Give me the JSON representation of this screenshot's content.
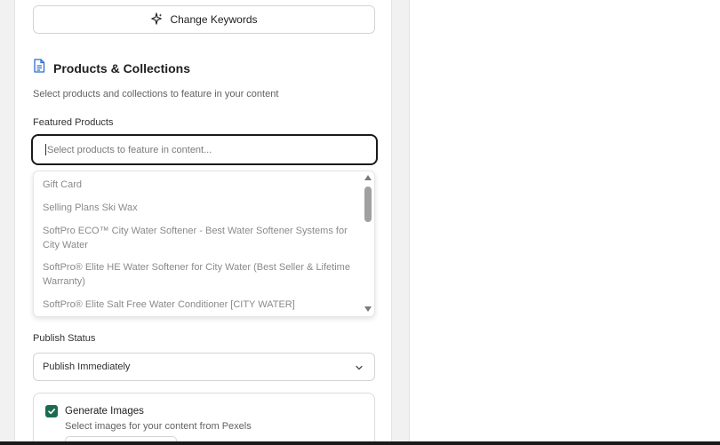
{
  "keywords": {
    "change_label": "Change Keywords",
    "icon": "sparkle-icon"
  },
  "products_section": {
    "title": "Products & Collections",
    "icon": "document-icon",
    "description": "Select products and collections to feature in your content",
    "featured_label": "Featured Products",
    "input_placeholder": "Select products to feature in content..."
  },
  "product_options": [
    {
      "label": "Gift Card"
    },
    {
      "label": "Selling Plans Ski Wax"
    },
    {
      "label": "SoftPro ECO™ City Water Softener - Best Water Softener Systems for City Water"
    },
    {
      "label": "SoftPro® Elite HE Water Softener for City Water (Best Seller & Lifetime Warranty)"
    },
    {
      "label": "SoftPro® Elite Salt Free Water Conditioner [CITY WATER]"
    }
  ],
  "publish": {
    "label": "Publish Status",
    "selected": "Publish Immediately"
  },
  "images": {
    "checked": true,
    "label": "Generate Images",
    "description": "Select images for your content from Pexels"
  },
  "colors": {
    "accent": "#1b6b52",
    "input_border_focus": "#1a1a1a",
    "background": "#f1f1f1"
  }
}
